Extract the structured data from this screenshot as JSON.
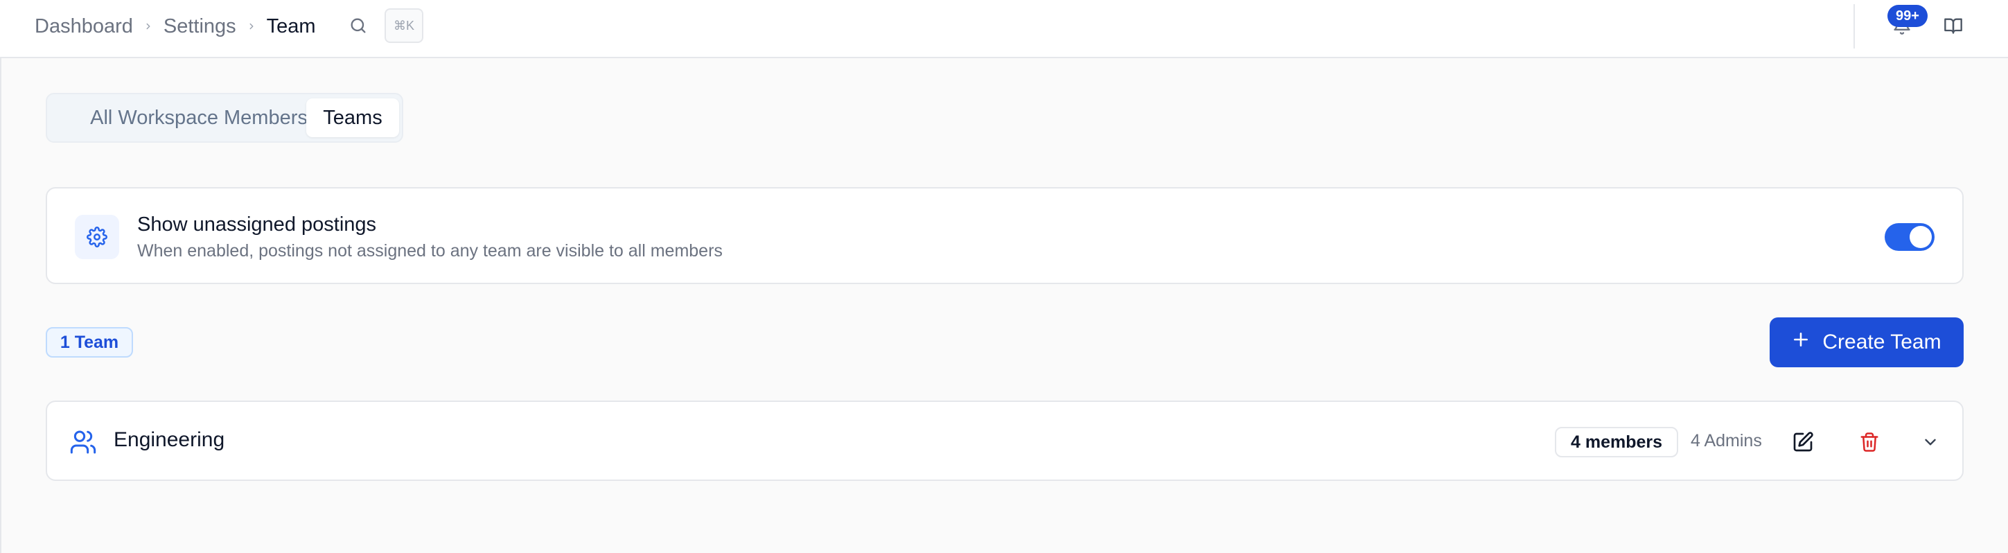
{
  "breadcrumb": [
    "Dashboard",
    "Settings",
    "Team"
  ],
  "search": {
    "shortcut": "⌘K"
  },
  "notifications": {
    "count": "99+"
  },
  "tabs": [
    {
      "label": "All Workspace Members",
      "active": false
    },
    {
      "label": "Teams",
      "active": true
    }
  ],
  "setting": {
    "title": "Show unassigned postings",
    "description": "When enabled, postings not assigned to any team are visible to all members",
    "enabled": true
  },
  "team_count": "1 Team",
  "create_button": "Create Team",
  "teams": [
    {
      "name": "Engineering",
      "members": "4 members",
      "admins": "4 Admins"
    }
  ],
  "colors": {
    "accent": "#1d4ed8",
    "danger": "#dc2626",
    "background": "#fafafa"
  },
  "icons": [
    "chevron-right-icon",
    "search-icon",
    "bell-icon",
    "book-icon",
    "gear-icon",
    "plus-icon",
    "users-icon",
    "edit-icon",
    "trash-icon",
    "chevron-down-icon"
  ]
}
